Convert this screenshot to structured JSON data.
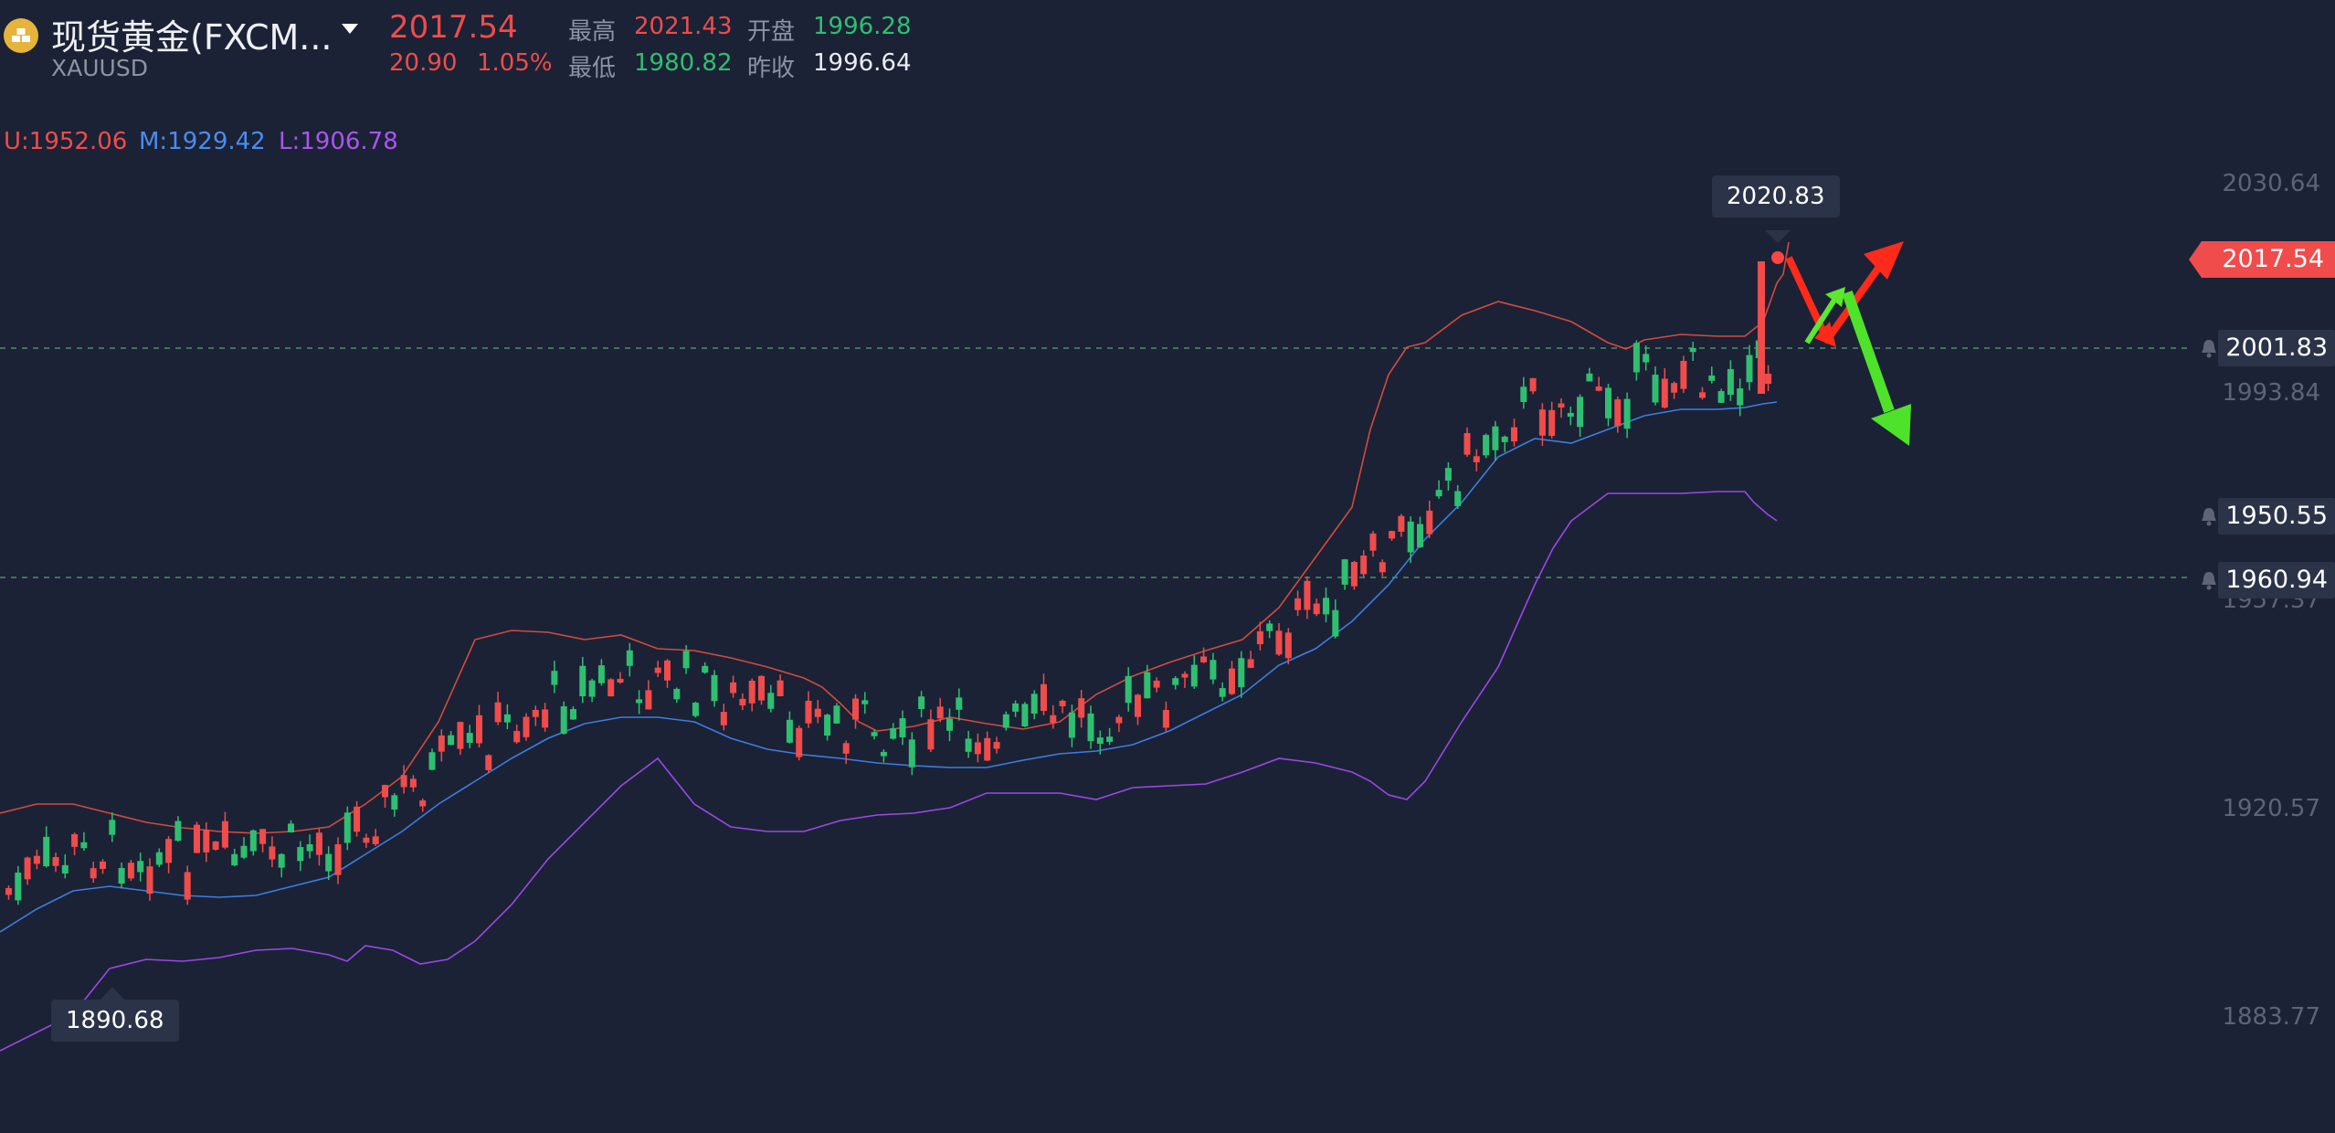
{
  "header": {
    "title": "现货黄金(FXCM...",
    "symbol": "XAUUSD",
    "price": "2017.54",
    "change": "20.90",
    "change_pct": "1.05%",
    "high_label": "最高",
    "high_value": "2021.43",
    "low_label": "最低",
    "low_value": "1980.82",
    "open_label": "开盘",
    "open_value": "1996.28",
    "prevclose_label": "昨收",
    "prevclose_value": "1996.64"
  },
  "boll": {
    "upper": "U:1952.06",
    "middle": "M:1929.42",
    "lower": "L:1906.78"
  },
  "axis": {
    "labels": [
      "2030.64",
      "1993.84",
      "1957.37",
      "1920.57",
      "1883.77"
    ]
  },
  "price_tag": "2017.54",
  "alerts": [
    "2001.83",
    "1950.55",
    "1960.94"
  ],
  "callouts": {
    "high": "2020.83",
    "low": "1890.68"
  },
  "colors": {
    "bg": "#1b2235",
    "up": "#ef4c4b",
    "down": "#2fbf71",
    "upper_band": "#d24a3f",
    "middle_band": "#3d7de0",
    "lower_band": "#9a48e6",
    "arrow_red": "#ff2a1a",
    "arrow_green": "#4fe22b"
  },
  "icons": [
    "coin-icon",
    "chevron-down-icon",
    "bell-icon"
  ]
}
